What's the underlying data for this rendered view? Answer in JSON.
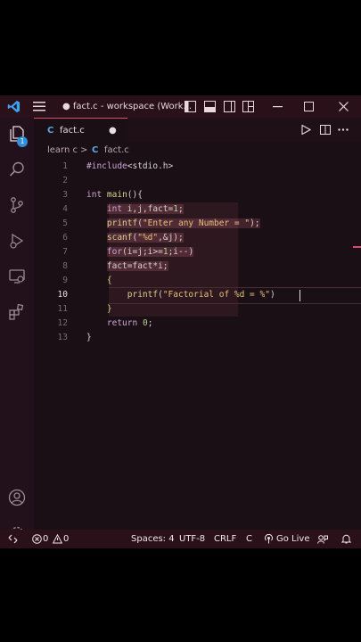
{
  "titlebar": {
    "title": "● fact.c - workspace (Work..."
  },
  "tabs": [
    {
      "label": "fact.c",
      "lang_badge": "C",
      "modified_marker": "●"
    }
  ],
  "activity": {
    "badge_count": "1"
  },
  "breadcrumb": {
    "folder": "learn c",
    "separator": ">",
    "file_badge": "C",
    "file": "fact.c"
  },
  "editor": {
    "line_numbers": [
      "1",
      "2",
      "3",
      "4",
      "5",
      "6",
      "7",
      "8",
      "9",
      "10",
      "11",
      "12",
      "13"
    ],
    "active_line": "10"
  },
  "statusbar": {
    "errors": "0",
    "warnings": "0",
    "spaces": "Spaces: 4",
    "encoding": "UTF-8",
    "eol": "CRLF",
    "language": "C",
    "golive": "Go Live"
  },
  "colors": {
    "accent": "#d84a6e",
    "titlebar_bg": "#2a1018",
    "editor_bg": "#1a0f14"
  }
}
